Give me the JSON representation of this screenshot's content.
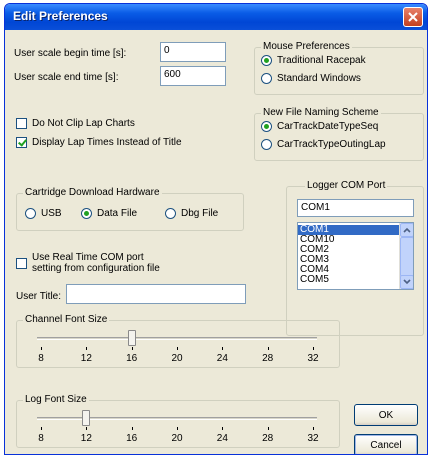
{
  "window": {
    "title": "Edit Preferences"
  },
  "fields": {
    "begin_label": "User scale begin time [s]:",
    "begin_value": "0",
    "end_label": "User scale end time [s]:",
    "end_value": "600",
    "title_label": "User Title:",
    "title_value": ""
  },
  "mouse_prefs": {
    "title": "Mouse Preferences",
    "options": [
      "Traditional Racepak",
      "Standard Windows"
    ],
    "selected": 0
  },
  "naming": {
    "title": "New File Naming Scheme",
    "options": [
      "CarTrackDateTypeSeq",
      "CarTrackTypeOutingLap"
    ],
    "selected": 0
  },
  "checkboxes": {
    "no_clip_label": "Do Not Clip Lap Charts",
    "no_clip_checked": false,
    "lap_times_label": "Display Lap Times Instead of Title",
    "lap_times_checked": true,
    "realtime_label_1": "Use Real Time COM port",
    "realtime_label_2": "setting from configuration file",
    "realtime_checked": false
  },
  "cartridge": {
    "title": "Cartridge Download Hardware",
    "options": [
      "USB",
      "Data File",
      "Dbg File"
    ],
    "selected": 1
  },
  "logger": {
    "title": "Logger COM Port",
    "value": "COM1",
    "items": [
      "COM1",
      "COM10",
      "COM2",
      "COM3",
      "COM4",
      "COM5"
    ],
    "selected": 0
  },
  "channel_font": {
    "title": "Channel Font Size",
    "ticks": [
      "8",
      "12",
      "16",
      "20",
      "24",
      "28",
      "32"
    ],
    "value": 16
  },
  "log_font": {
    "title": "Log Font Size",
    "ticks": [
      "8",
      "12",
      "16",
      "20",
      "24",
      "28",
      "32"
    ],
    "value": 12
  },
  "buttons": {
    "ok": "OK",
    "cancel": "Cancel"
  }
}
